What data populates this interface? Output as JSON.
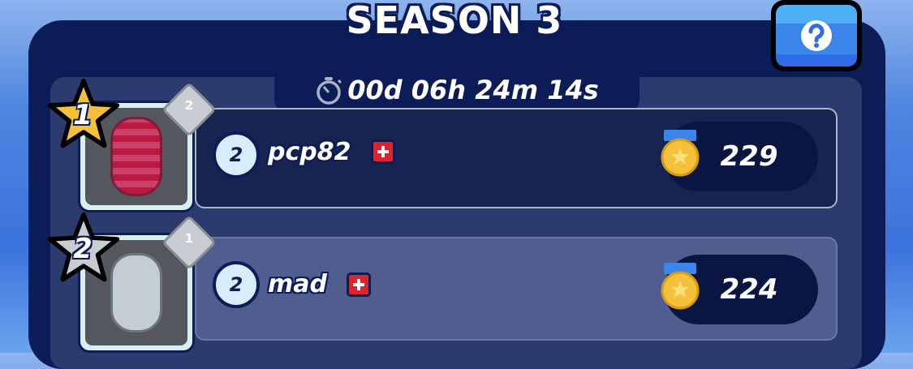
{
  "header": {
    "title": "SEASON 3",
    "timer": "00d 06h 24m 14s",
    "timer_icon": "stopwatch-icon",
    "help_icon": "question-icon"
  },
  "colors": {
    "panel": "#0b1c56",
    "inner": "#2b3b6e",
    "row_self": "#4f5e8e",
    "row": "#17244f",
    "gold": "#f5c13a",
    "silver": "#c9ccd2",
    "help": "#3a86ea"
  },
  "leaderboard": [
    {
      "rank": "1",
      "rank_medal": "gold",
      "car_level": "2",
      "player_level": "2",
      "name": "pcp82",
      "flag": "switzerland-flag",
      "score": "229",
      "car_color": "pink-plaid"
    },
    {
      "rank": "2",
      "rank_medal": "silver",
      "car_level": "1",
      "player_level": "2",
      "name": "mad",
      "flag": "switzerland-flag",
      "score": "224",
      "car_color": "silver"
    }
  ]
}
